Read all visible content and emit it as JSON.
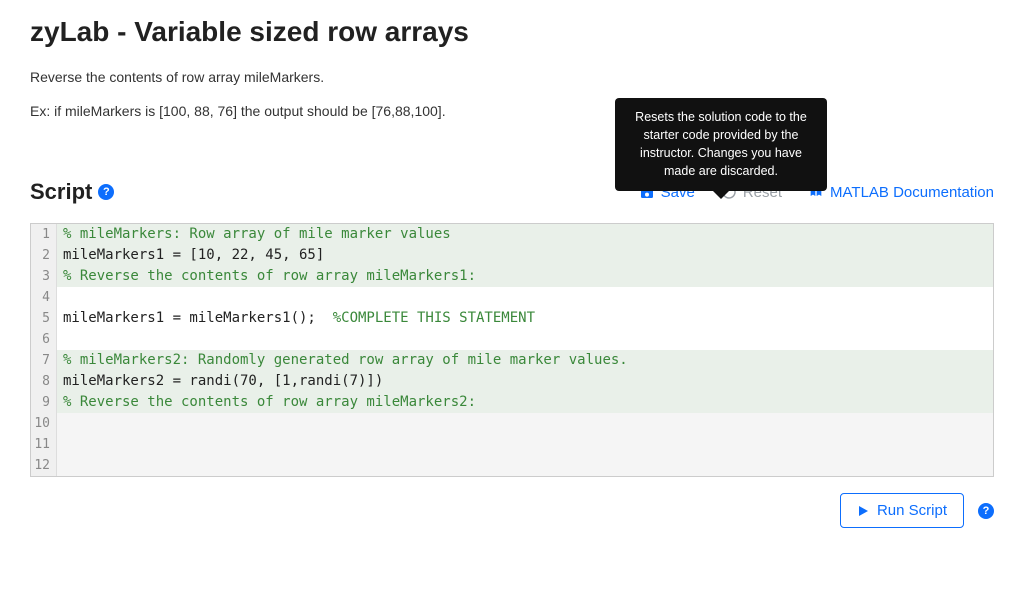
{
  "title": "zyLab - Variable sized row arrays",
  "description1": "Reverse the contents of row array mileMarkers.",
  "description2": "Ex: if mileMarkers is [100, 88, 76] the output should be [76,88,100].",
  "tooltip": "Resets the solution code to the starter code provided by the instructor. Changes you have made are discarded.",
  "scriptLabel": "Script",
  "toolbar": {
    "save": "Save",
    "reset": "Reset",
    "docs": "MATLAB Documentation"
  },
  "runLabel": "Run Script",
  "code": {
    "lines": [
      {
        "n": "1",
        "bg": "comment",
        "tokens": [
          {
            "cls": "comment",
            "t": "% mileMarkers: Row array of mile marker values"
          }
        ]
      },
      {
        "n": "2",
        "bg": "comment",
        "tokens": [
          {
            "cls": "code",
            "t": "mileMarkers1 = [10, 22, 45, 65]"
          }
        ]
      },
      {
        "n": "3",
        "bg": "comment",
        "tokens": [
          {
            "cls": "comment",
            "t": "% Reverse the contents of row array mileMarkers1:"
          }
        ]
      },
      {
        "n": "4",
        "bg": "plain",
        "tokens": [
          {
            "cls": "code",
            "t": ""
          }
        ]
      },
      {
        "n": "5",
        "bg": "plain",
        "tokens": [
          {
            "cls": "code",
            "t": "mileMarkers1 = mileMarkers1();  "
          },
          {
            "cls": "comment",
            "t": "%COMPLETE THIS STATEMENT"
          }
        ]
      },
      {
        "n": "6",
        "bg": "plain",
        "tokens": [
          {
            "cls": "code",
            "t": ""
          }
        ]
      },
      {
        "n": "7",
        "bg": "comment",
        "tokens": [
          {
            "cls": "comment",
            "t": "% mileMarkers2: Randomly generated row array of mile marker values."
          }
        ]
      },
      {
        "n": "8",
        "bg": "comment",
        "tokens": [
          {
            "cls": "code",
            "t": "mileMarkers2 = randi(70, [1,randi(7)])"
          }
        ]
      },
      {
        "n": "9",
        "bg": "comment",
        "tokens": [
          {
            "cls": "comment",
            "t": "% Reverse the contents of row array mileMarkers2:"
          }
        ]
      },
      {
        "n": "10",
        "bg": "empty",
        "tokens": [
          {
            "cls": "code",
            "t": ""
          }
        ]
      },
      {
        "n": "11",
        "bg": "empty",
        "tokens": [
          {
            "cls": "code",
            "t": ""
          }
        ]
      },
      {
        "n": "12",
        "bg": "empty",
        "tokens": [
          {
            "cls": "code",
            "t": ""
          }
        ]
      }
    ]
  }
}
